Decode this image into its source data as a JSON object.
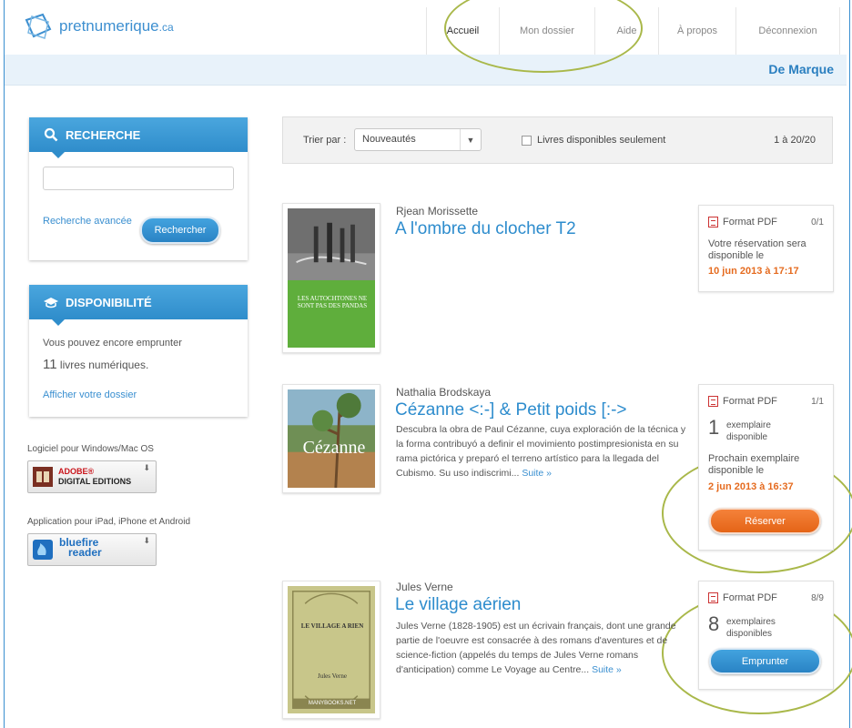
{
  "header": {
    "logo_main": "pret",
    "logo_bold": "numerique",
    "logo_tld": ".ca",
    "nav": [
      {
        "label": "Accueil"
      },
      {
        "label": "Mon dossier"
      },
      {
        "label": "Aide"
      },
      {
        "label": "À propos"
      },
      {
        "label": "Déconnexion"
      }
    ],
    "brand": "De Marque"
  },
  "search": {
    "title": "RECHERCHE",
    "advanced_link": "Recherche avancée",
    "button": "Rechercher",
    "value": ""
  },
  "availability": {
    "title": "DISPONIBILITÉ",
    "line1": "Vous pouvez encore emprunter",
    "count": "11",
    "unit": "livres numériques.",
    "link": "Afficher votre dossier"
  },
  "software": {
    "desktop_label": "Logiciel pour Windows/Mac OS",
    "desktop_badge_line1": "ADOBE®",
    "desktop_badge_line2": "DIGITAL EDITIONS",
    "mobile_label": "Application pour iPad, iPhone et Android",
    "mobile_badge_line1": "bluefire",
    "mobile_badge_line2": "reader"
  },
  "sortbar": {
    "label": "Trier par :",
    "selected": "Nouveautés",
    "checkbox_label": "Livres disponibles seulement",
    "results": "1 à 20/20"
  },
  "books": [
    {
      "author": "Rjean Morissette",
      "title": "A l'ombre du clocher T2",
      "cover_text": "LES AUTOCHTONES NE SONT PAS DES PANDAS",
      "format": "Format PDF",
      "copies": "0/1",
      "status_line": "Votre réservation sera disponible le",
      "date": "10 jun 2013 à 17:17"
    },
    {
      "author": "Nathalia Brodskaya",
      "title": "Cézanne <:-] & Petit poids [:->",
      "description": "Descubra la obra de Paul Cézanne, cuya exploración de la técnica y la forma contribuyó a definir el movimiento postimpresionista en su rama pictórica y preparó el terreno artístico para la llegada del Cubismo. Su uso indiscrimi...",
      "more": "Suite »",
      "cover_text": "Cézanne",
      "format": "Format PDF",
      "copies": "1/1",
      "avail_num": "1",
      "avail_text": "exemplaire disponible",
      "next_label": "Prochain exemplaire disponible le",
      "date": "2 jun 2013 à 16:37",
      "button": "Réserver"
    },
    {
      "author": "Jules Verne",
      "title": "Le village aérien",
      "description": "Jules Verne (1828-1905) est un écrivain français, dont une grande partie de l'oeuvre est consacrée à des romans d'aventures et de science-fiction (appelés du temps de Jules Verne romans d'anticipation) comme Le Voyage au Centre...",
      "more": "Suite »",
      "cover_title": "LE VILLAGE A RIEN",
      "cover_author": "Jules Verne",
      "cover_footer": "MANYBOOKS.NET",
      "format": "Format PDF",
      "copies": "8/9",
      "avail_num": "8",
      "avail_text": "exemplaires disponibles",
      "button": "Emprunter"
    }
  ],
  "colors": {
    "accent_blue": "#2d8ccd",
    "accent_orange": "#e56b1f",
    "annotation_green": "#a9b84a"
  }
}
